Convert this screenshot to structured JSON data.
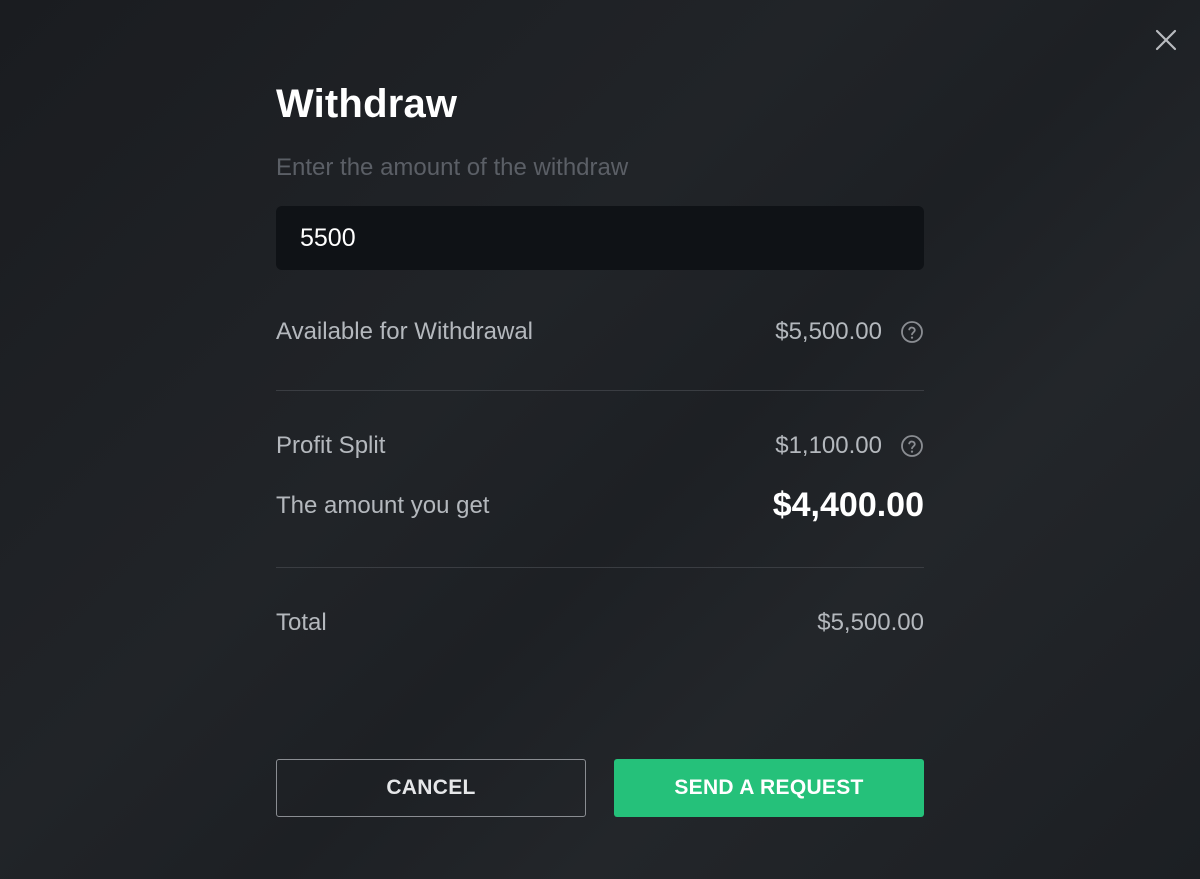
{
  "dialog": {
    "title": "Withdraw",
    "subtitle": "Enter the amount of the withdraw",
    "amount_input": {
      "value": "5500",
      "placeholder": ""
    }
  },
  "summary": {
    "available": {
      "label": "Available for Withdrawal",
      "value": "$5,500.00",
      "icon": "help-circle-icon"
    },
    "profit_split": {
      "label": "Profit Split",
      "value": "$1,100.00",
      "icon": "help-circle-icon"
    },
    "you_get": {
      "label": "The amount you get",
      "value": "$4,400.00"
    },
    "total": {
      "label": "Total",
      "value": "$5,500.00"
    }
  },
  "actions": {
    "cancel_label": "CANCEL",
    "send_label": "SEND A REQUEST"
  },
  "colors": {
    "accent": "#25c17a",
    "background": "#1c1f23",
    "input_bg": "#0f1216"
  },
  "icons": {
    "close": "close-icon"
  }
}
